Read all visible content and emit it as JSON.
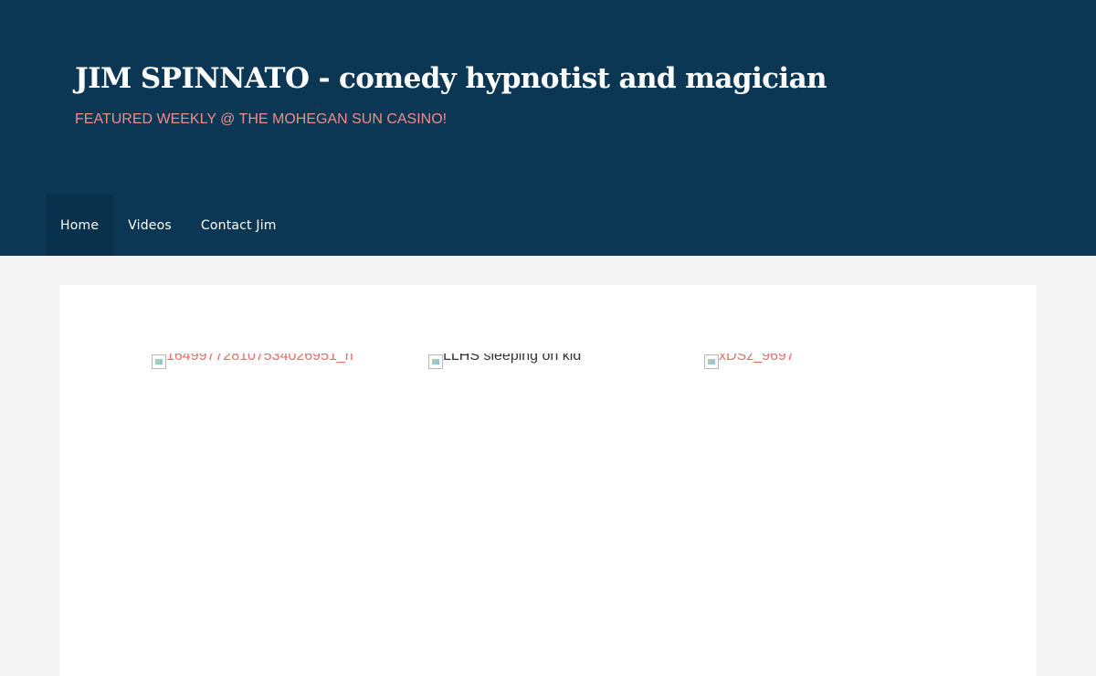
{
  "header": {
    "title": "JIM SPINNATO - comedy hypnotist and magician",
    "tagline": "FEATURED WEEKLY @ THE MOHEGAN SUN CASINO!"
  },
  "nav": {
    "items": [
      {
        "label": "Home",
        "active": true
      },
      {
        "label": "Videos",
        "active": false
      },
      {
        "label": "Contact Jim",
        "active": false
      }
    ]
  },
  "gallery": {
    "items": [
      {
        "alt": "164997728107534026951_n",
        "icon": "broken-image-icon"
      },
      {
        "alt": "LLHS sleeping on kid",
        "icon": "broken-image-icon"
      },
      {
        "alt": "xDSz_9697",
        "icon": "broken-image-icon"
      }
    ]
  },
  "colors": {
    "header_bg": "#0c3754",
    "nav_active_bg": "#0a314b",
    "tagline": "#f08c8c",
    "page_bg": "#f4f4f4",
    "link": "#e8706a"
  }
}
